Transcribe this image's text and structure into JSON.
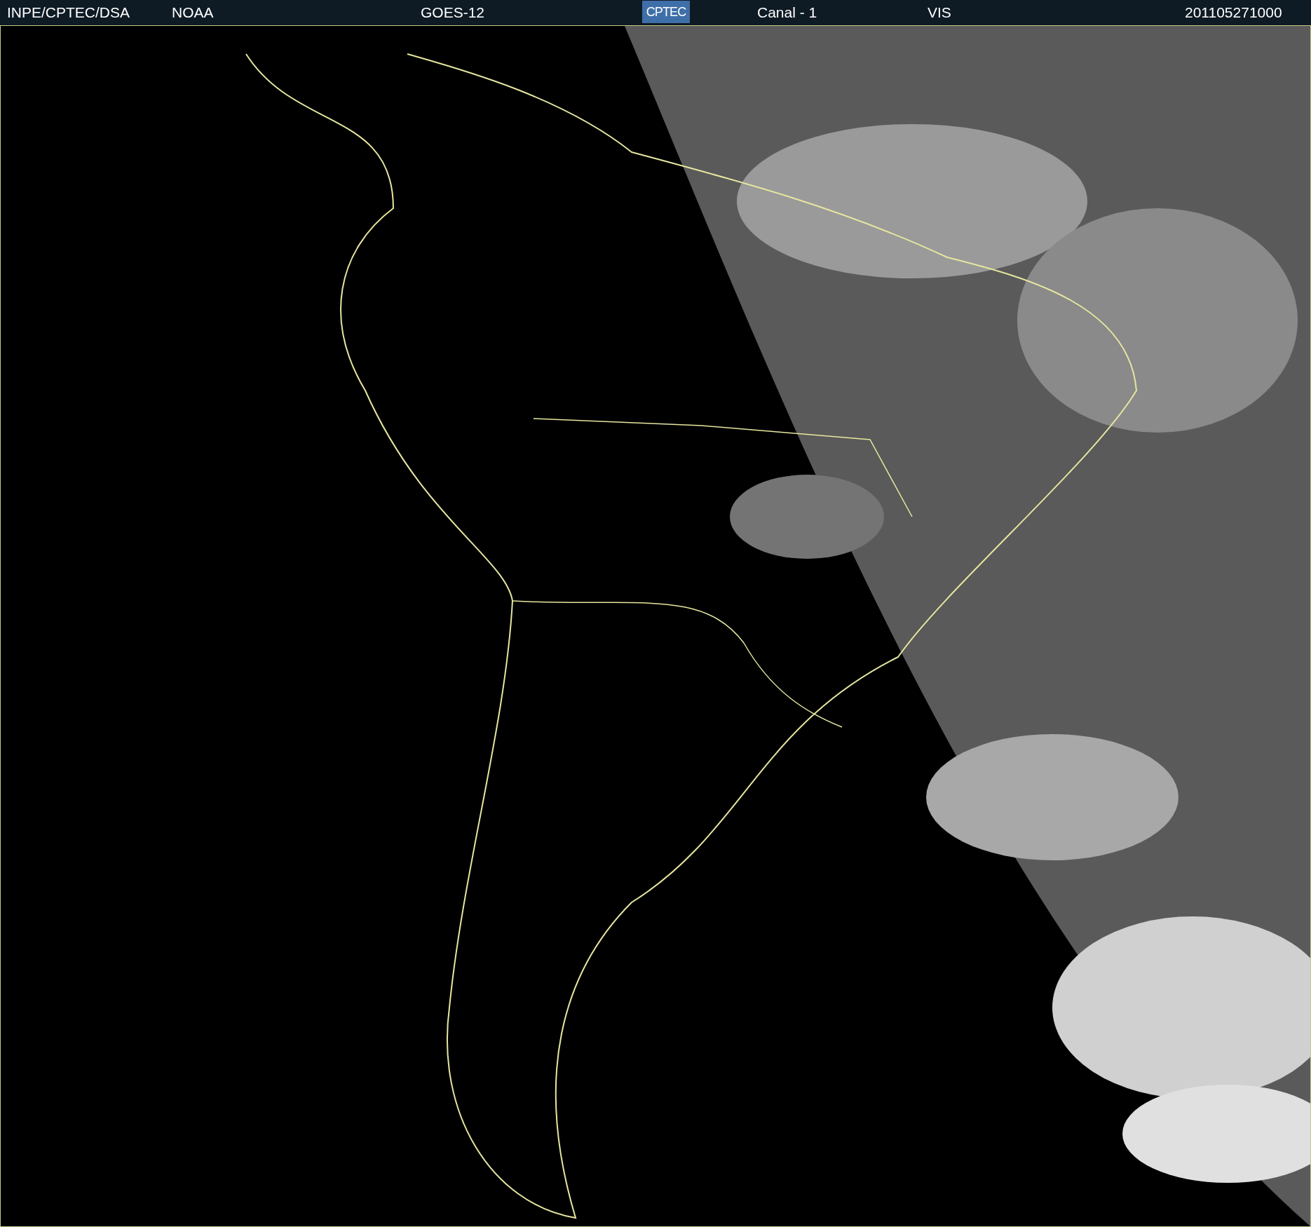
{
  "header": {
    "source": "INPE/CPTEC/DSA",
    "agency": "NOAA",
    "satellite": "GOES-12",
    "logo": "CPTEC",
    "channel": "Canal - 1",
    "band": "VIS",
    "timestamp": "201105271000"
  }
}
